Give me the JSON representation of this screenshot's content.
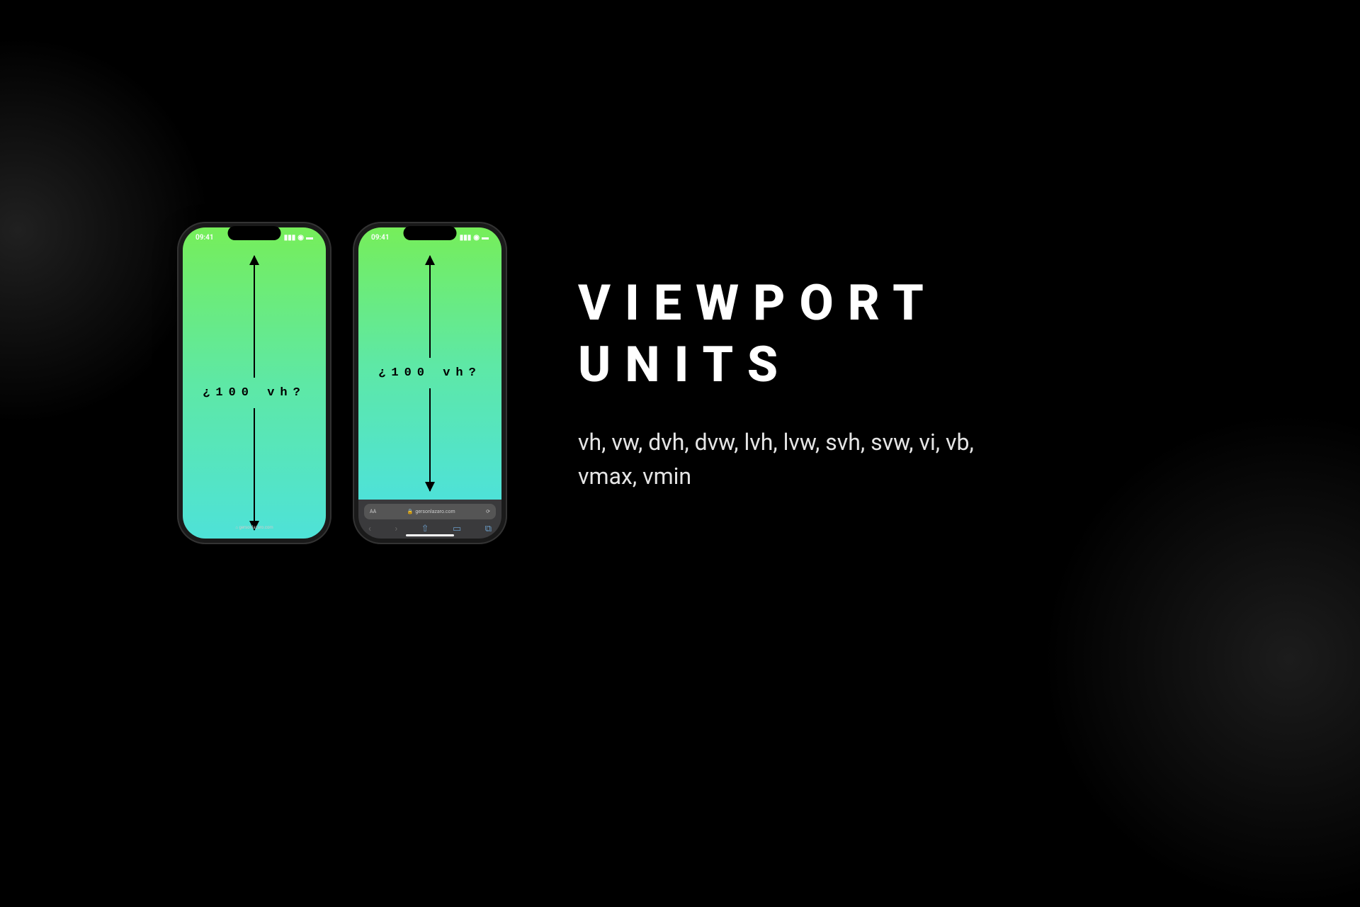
{
  "title_line1": "VIEWPORT",
  "title_line2": "UNITS",
  "subtitle": "vh, vw, dvh, dvw, lvh, lvw, svh, svw, vi, vb, vmax, vmin",
  "phone_a": {
    "time": "09:41",
    "vh_label": "¿100 vh?",
    "address": "⌂ gersonlazaro.com"
  },
  "phone_b": {
    "time": "09:41",
    "vh_label": "¿100 vh?",
    "url_aa": "AA",
    "url_lock": "🔒",
    "url_domain": "gersonlazaro.com",
    "url_refresh": "⟳"
  }
}
